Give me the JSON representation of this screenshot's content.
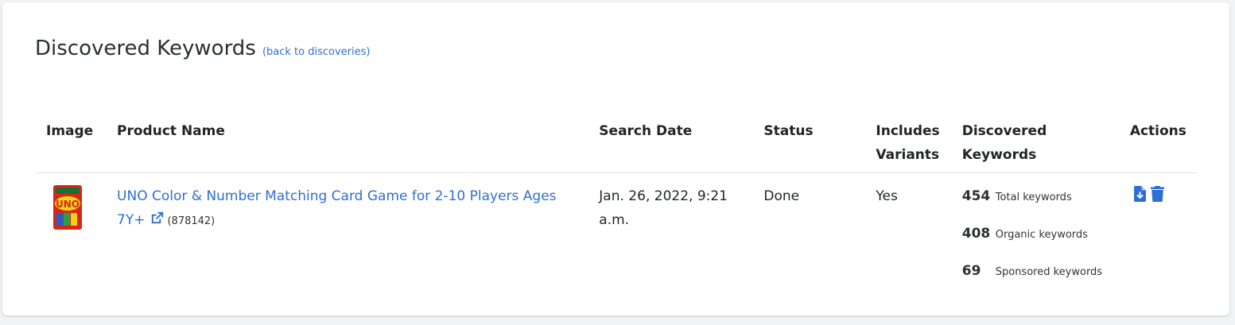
{
  "page": {
    "title": "Discovered Keywords",
    "back_link": "(back to discoveries)"
  },
  "table": {
    "headers": {
      "image": "Image",
      "product_name": "Product Name",
      "search_date": "Search Date",
      "status": "Status",
      "includes_variants": "Includes Variants",
      "discovered_keywords": "Discovered Keywords",
      "actions": "Actions"
    },
    "rows": [
      {
        "product_name": "UNO Color & Number Matching Card Game for 2-10 Players Ages 7Y+",
        "product_id": "(878142)",
        "search_date": "Jan. 26, 2022, 9:21 a.m.",
        "status": "Done",
        "includes_variants": "Yes",
        "keywords": {
          "total_count": "454",
          "total_label": "Total keywords",
          "organic_count": "408",
          "organic_label": "Organic keywords",
          "sponsored_count": "69",
          "sponsored_label": "Sponsored keywords"
        },
        "image_text": "UNO"
      }
    ]
  },
  "icons": {
    "external_link": "external-link-icon",
    "download": "file-download-icon",
    "delete": "trash-icon"
  },
  "colors": {
    "link": "#2f6fd1",
    "action_icon": "#2f6fd1"
  }
}
